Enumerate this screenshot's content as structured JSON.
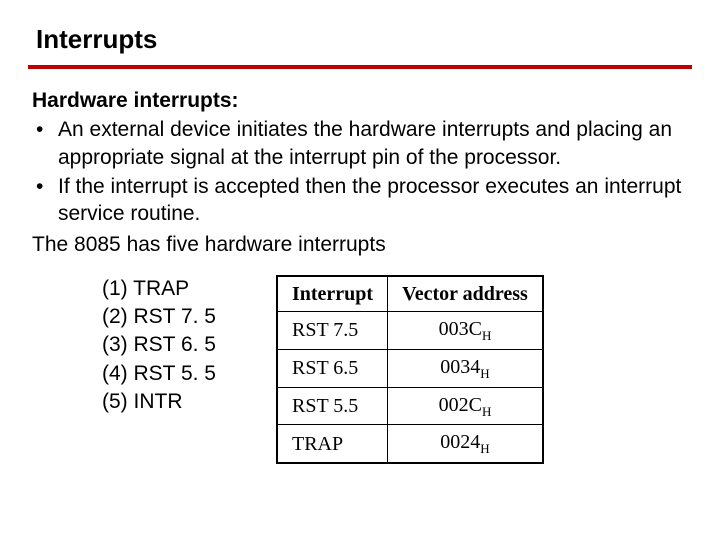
{
  "title": "Interrupts",
  "subheading": "Hardware interrupts:",
  "bullets": [
    "An external device initiates the hardware interrupts and placing an appropriate signal at the interrupt pin of the processor.",
    "If the interrupt is accepted then the processor executes an interrupt service routine."
  ],
  "midline": "The 8085 has five hardware interrupts",
  "enum": [
    "(1) TRAP",
    "(2) RST 7. 5",
    "(3) RST 6. 5",
    "(4) RST 5. 5",
    "(5) INTR"
  ],
  "table": {
    "headers": [
      "Interrupt",
      "Vector address"
    ],
    "rows": [
      {
        "name": "RST 7.5",
        "addr": "003C",
        "sub": "H"
      },
      {
        "name": "RST 6.5",
        "addr": "0034",
        "sub": "H"
      },
      {
        "name": "RST 5.5",
        "addr": "002C",
        "sub": "H"
      },
      {
        "name": "TRAP",
        "addr": "0024",
        "sub": "H"
      }
    ]
  }
}
